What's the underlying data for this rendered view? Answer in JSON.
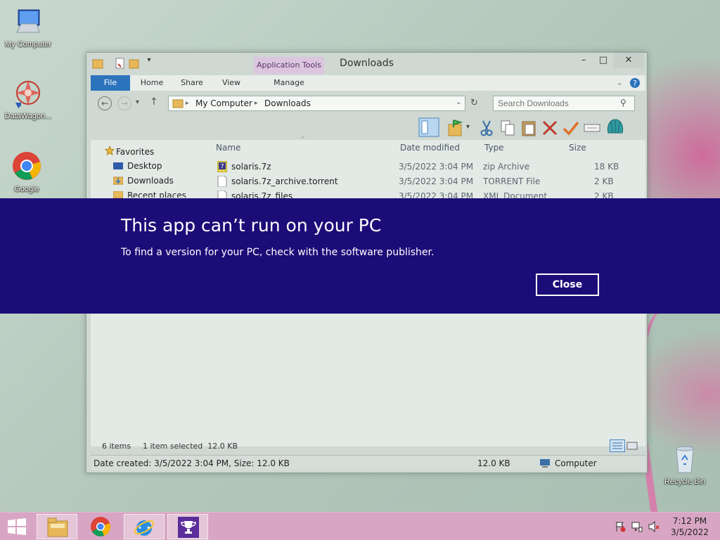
{
  "desktop": {
    "icons": [
      {
        "label": "My Computer"
      },
      {
        "label": "DataWagon..."
      },
      {
        "label": "Google"
      },
      {
        "label": "Recycle Bin"
      }
    ]
  },
  "explorer": {
    "title": "Downloads",
    "context_tab": "Application Tools",
    "ribbon_tabs": [
      "File",
      "Home",
      "Share",
      "View",
      "Manage"
    ],
    "address": {
      "root": "My Computer",
      "folder": "Downloads"
    },
    "search": {
      "placeholder": "Search Downloads"
    },
    "nav_pane": {
      "favorites_label": "Favorites",
      "items": [
        "Desktop",
        "Downloads",
        "Recent places"
      ]
    },
    "columns": [
      "Name",
      "Date modified",
      "Type",
      "Size"
    ],
    "files": [
      {
        "name": "solaris.7z",
        "date": "3/5/2022 3:04 PM",
        "type": "zip Archive",
        "size": "18 KB"
      },
      {
        "name": "solaris.7z_archive.torrent",
        "date": "3/5/2022 3:04 PM",
        "type": "TORRENT File",
        "size": "2 KB"
      },
      {
        "name": "solaris.7z_files",
        "date": "3/5/2022 3:04 PM",
        "type": "XML Document",
        "size": "2 KB"
      }
    ],
    "status": {
      "items": "6 items",
      "selected": "1 item selected  12.0 KB"
    },
    "details": {
      "info": "Date created: 3/5/2022 3:04 PM, Size: 12.0 KB",
      "size": "12.0 KB",
      "location": "Computer"
    }
  },
  "modal": {
    "heading": "This app can’t run on your PC",
    "message": "To find a version for your PC, check with the software publisher.",
    "close_label": "Close"
  },
  "taskbar": {
    "time": "7:12 PM",
    "date": "3/5/2022"
  },
  "colors": {
    "modal_bg": "#1c0c78",
    "file_tab": "#2b73bd",
    "taskbar": "#d8a6c4"
  }
}
